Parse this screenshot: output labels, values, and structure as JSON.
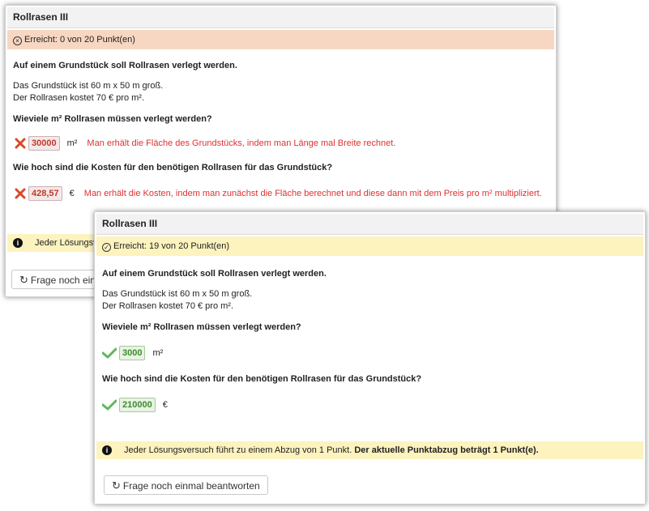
{
  "card1": {
    "title": "Rollrasen III",
    "status": "Erreicht: 0 von 20 Punkt(en)",
    "intro": "Auf einem Grundstück soll Rollrasen verlegt werden.",
    "desc1": "Das Grundstück ist 60 m x 50 m groß.",
    "desc2": "Der Rollrasen kostet 70 € pro m².",
    "q1": "Wieviele m² Rollrasen müssen verlegt werden?",
    "a1_value": "30000",
    "a1_unit": "m²",
    "a1_feedback": "Man erhält die Fläche des Grundstücks, indem man Länge mal Breite rechnet.",
    "q2": "Wie hoch sind die Kosten für den benötigen Rollrasen für das Grundstück?",
    "a2_value": "428,57",
    "a2_unit": "€",
    "a2_feedback": "Man erhält die Kosten, indem man zunächst die Fläche berechnet und diese dann mit dem Preis pro m² multipliziert.",
    "info_text": "Jeder Lösungsvers",
    "button_label": "Frage noch einma"
  },
  "card2": {
    "title": "Rollrasen III",
    "status": "Erreicht: 19 von 20 Punkt(en)",
    "intro": "Auf einem Grundstück soll Rollrasen verlegt werden.",
    "desc1": "Das Grundstück ist 60 m x 50 m groß.",
    "desc2": "Der Rollrasen kostet 70 € pro m².",
    "q1": "Wieviele m² Rollrasen müssen verlegt werden?",
    "a1_value": "3000",
    "a1_unit": "m²",
    "q2": "Wie hoch sind die Kosten für den benötigen Rollrasen für das Grundstück?",
    "a2_value": "210000",
    "a2_unit": "€",
    "info_text": "Jeder Lösungsversuch führt zu einem Abzug von 1 Punkt.",
    "info_bold": "Der aktuelle Punktabzug beträgt 1 Punkt(e).",
    "button_label": "Frage noch einmal beantworten"
  },
  "colors": {
    "fail_bg": "#f8d7c2",
    "ok_bg": "#fcf3bf",
    "error_text": "#e03030",
    "correct_green": "#3c8b2c"
  },
  "icons": [
    "close-circle-icon",
    "cross-icon",
    "check-icon",
    "info-icon",
    "refresh-icon",
    "check-circle-icon"
  ]
}
